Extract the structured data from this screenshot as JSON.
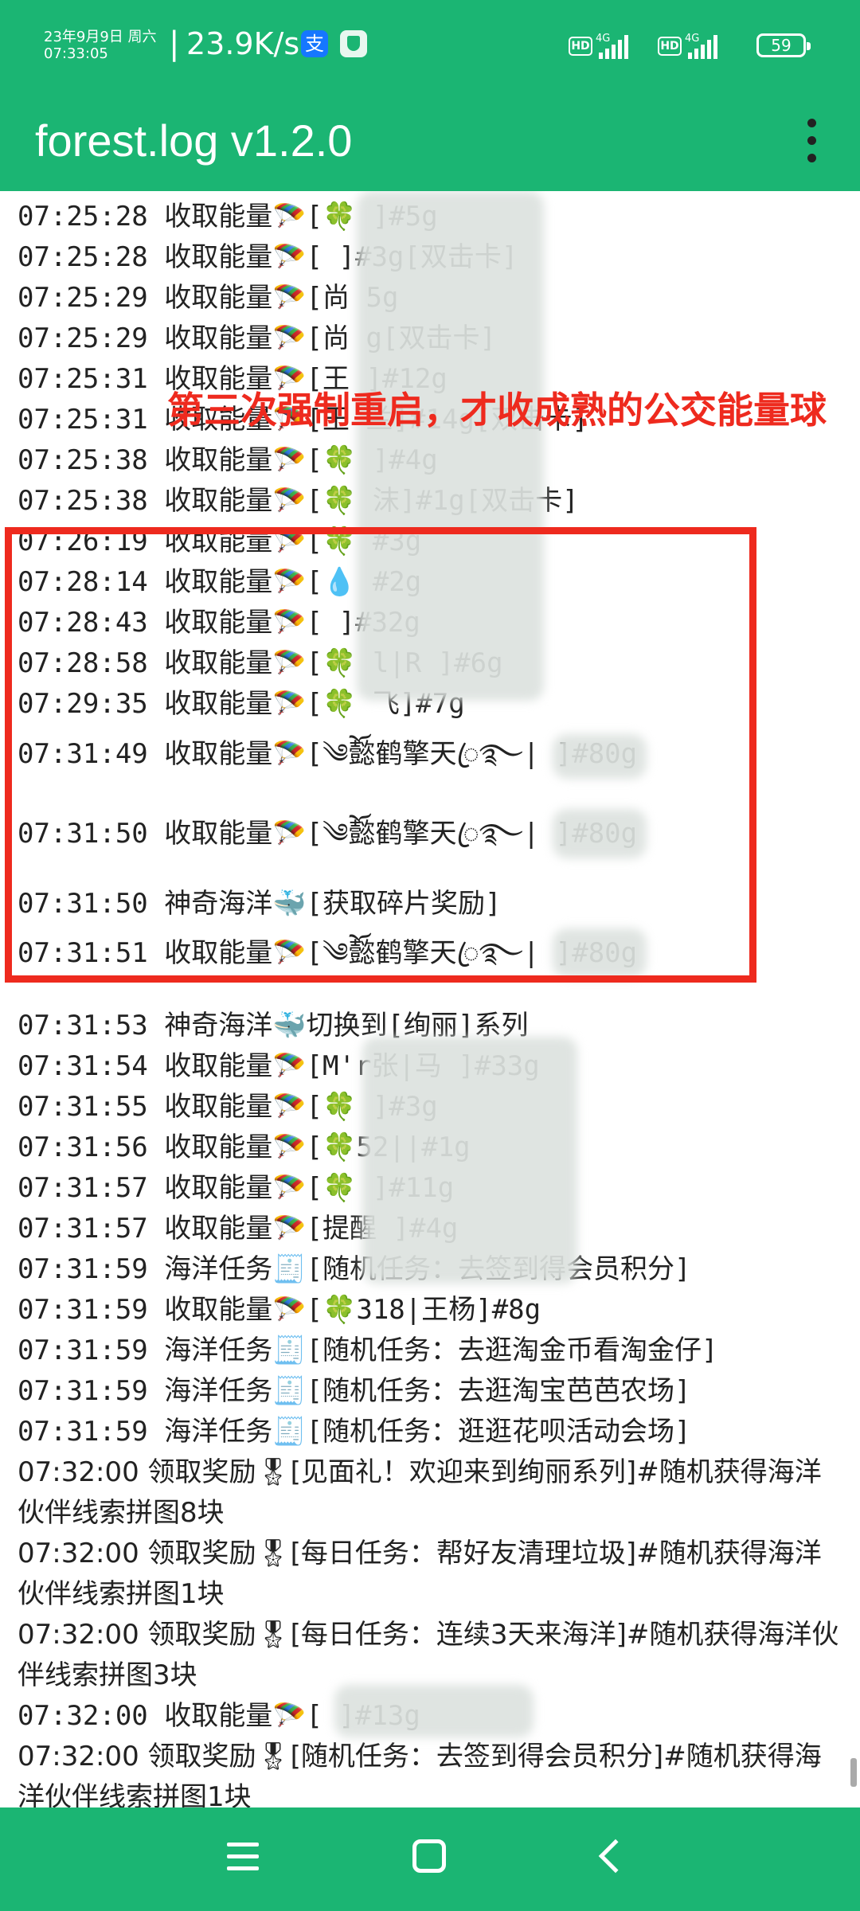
{
  "status_bar": {
    "date": "23年9月9日 周六",
    "time": "07:33:05",
    "speed": "23.9K/s",
    "alipay_icon": "支",
    "net1_type": "4G",
    "net2_type": "4G",
    "hd": "HD",
    "battery": "59"
  },
  "app_bar": {
    "title": "forest.log v1.2.0",
    "menu_icon": "more-vert-icon"
  },
  "annotation": {
    "note": "第三次强制重启，才收成熟的公交能量球",
    "box_color": "#ee2a1e"
  },
  "log_rows": [
    {
      "text": "07:25:28 收取能量🪂[🍀          ]#5g"
    },
    {
      "text": "07:25:28 收取能量🪂[           ]#3g[双击卡]"
    },
    {
      "text": "07:25:29 收取能量🪂[尚          5g"
    },
    {
      "text": "07:25:29 收取能量🪂[尚          g[双击卡]"
    },
    {
      "text": "07:25:31 收取能量🪂[王          ]#12g"
    },
    {
      "text": "07:25:31 收取能量🪂[王          兰]#14g[双击卡]"
    },
    {
      "text": "07:25:38 收取能量🪂[🍀          ]#4g"
    },
    {
      "text": "07:25:38 收取能量🪂[🍀          沫]#1g[双击卡]"
    },
    {
      "text": "07:26:19 收取能量🪂[🍀          #3g"
    },
    {
      "text": "07:28:14 收取能量🪂[💧          #2g"
    },
    {
      "text": "07:28:43 收取能量🪂[           ]#32g"
    },
    {
      "text": "07:28:58 收取能量🪂[🍀        l|R  ]#6g"
    },
    {
      "text": "07:29:35 收取能量🪂[🍀          飞]#7g"
    },
    {
      "text": "07:31:49 收取能量🪂[༄ོ懿鹤擎天ꦿ࿐|      ]#80g"
    },
    {
      "text": "07:31:50 收取能量🪂[༄ོ懿鹤擎天ꦿ࿐|      ]#80g"
    },
    {
      "text": "07:31:50 神奇海洋🐳[获取碎片奖励]"
    },
    {
      "text": "07:31:51 收取能量🪂[༄ོ懿鹤擎天ꦿ࿐|      ]#80g"
    },
    {
      "text": "07:31:53 神奇海洋🐳切换到[绚丽]系列"
    },
    {
      "text": "07:31:54 收取能量🪂[M'r张|马     ]#33g"
    },
    {
      "text": "07:31:55 收取能量🪂[🍀          ]#3g"
    },
    {
      "text": "07:31:56 收取能量🪂[🍀52||#1g"
    },
    {
      "text": "07:31:57 收取能量🪂[🍀          ]#11g"
    },
    {
      "text": "07:31:57 收取能量🪂[提醒          ]#4g"
    },
    {
      "text": "07:31:59 海洋任务🧾[随机任务：去签到得会员积分]"
    },
    {
      "text": "07:31:59 收取能量🪂[🍀318|王杨]#8g"
    },
    {
      "text": "07:31:59 海洋任务🧾[随机任务：去逛淘金币看淘金仔]"
    },
    {
      "text": "07:31:59 海洋任务🧾[随机任务：去逛淘宝芭芭农场]"
    },
    {
      "text": "07:31:59 海洋任务🧾[随机任务：逛逛花呗活动会场]"
    },
    {
      "text": "07:32:00 领取奖励🎖[见面礼！欢迎来到绚丽系列]#随机获得海洋伙伴线索拼图8块"
    },
    {
      "text": "07:32:00 领取奖励🎖[每日任务：帮好友清理垃圾]#随机获得海洋伙伴线索拼图1块"
    },
    {
      "text": "07:32:00 领取奖励🎖[每日任务：连续3天来海洋]#随机获得海洋伙伴线索拼图3块"
    },
    {
      "text": "07:32:00 收取能量🪂[           ]#13g"
    },
    {
      "text": "07:32:00 领取奖励🎖[随机任务：去签到得会员积分]#随机获得海洋伙伴线索拼图1块"
    }
  ],
  "nav_bar": {
    "menu_icon": "menu-icon",
    "home_icon": "home-icon",
    "back_icon": "back-icon"
  }
}
